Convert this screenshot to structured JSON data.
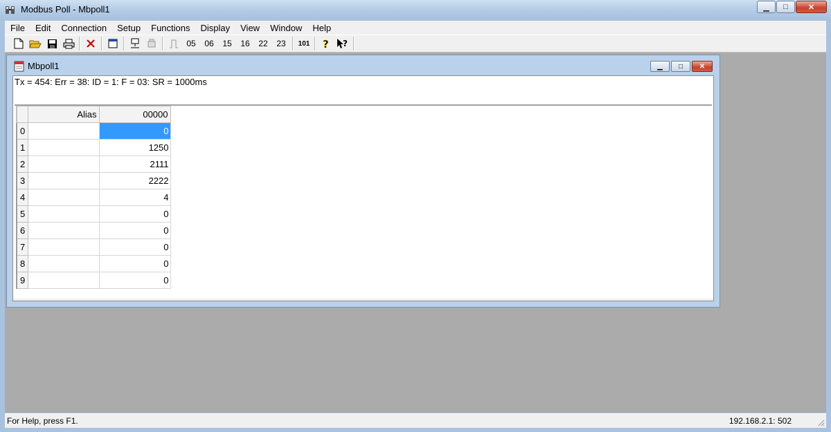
{
  "window": {
    "title": "Modbus Poll - Mbpoll1",
    "min_icon": "minimize-icon",
    "max_icon": "maximize-icon",
    "close_icon": "close-icon"
  },
  "menu": {
    "items": [
      {
        "label": "File"
      },
      {
        "label": "Edit"
      },
      {
        "label": "Connection"
      },
      {
        "label": "Setup"
      },
      {
        "label": "Functions"
      },
      {
        "label": "Display"
      },
      {
        "label": "View"
      },
      {
        "label": "Window"
      },
      {
        "label": "Help"
      }
    ]
  },
  "toolbar": {
    "icons": [
      "new-icon",
      "open-icon",
      "save-icon",
      "print-icon",
      "delete-icon",
      "window-icon",
      "connect-icon",
      "disconnect-icon",
      "pulse-icon"
    ],
    "function_buttons": [
      "05",
      "06",
      "15",
      "16",
      "22",
      "23"
    ],
    "extra": "101"
  },
  "child": {
    "title": "Mbpoll1",
    "status": "Tx = 454: Err = 38: ID = 1: F = 03: SR = 1000ms",
    "grid": {
      "headers": {
        "alias": "Alias",
        "address": "00000"
      },
      "rows": [
        {
          "index": "0",
          "alias": "",
          "value": "0"
        },
        {
          "index": "1",
          "alias": "",
          "value": "1250"
        },
        {
          "index": "2",
          "alias": "",
          "value": "2111"
        },
        {
          "index": "3",
          "alias": "",
          "value": "2222"
        },
        {
          "index": "4",
          "alias": "",
          "value": "4"
        },
        {
          "index": "5",
          "alias": "",
          "value": "0"
        },
        {
          "index": "6",
          "alias": "",
          "value": "0"
        },
        {
          "index": "7",
          "alias": "",
          "value": "0"
        },
        {
          "index": "8",
          "alias": "",
          "value": "0"
        },
        {
          "index": "9",
          "alias": "",
          "value": "0"
        }
      ]
    }
  },
  "statusbar": {
    "help": "For Help, press F1.",
    "connection": "192.168.2.1: 502"
  },
  "colors": {
    "selection": "#3399ff",
    "mdi_background": "#ababab",
    "chrome": "#f0f0f0"
  }
}
